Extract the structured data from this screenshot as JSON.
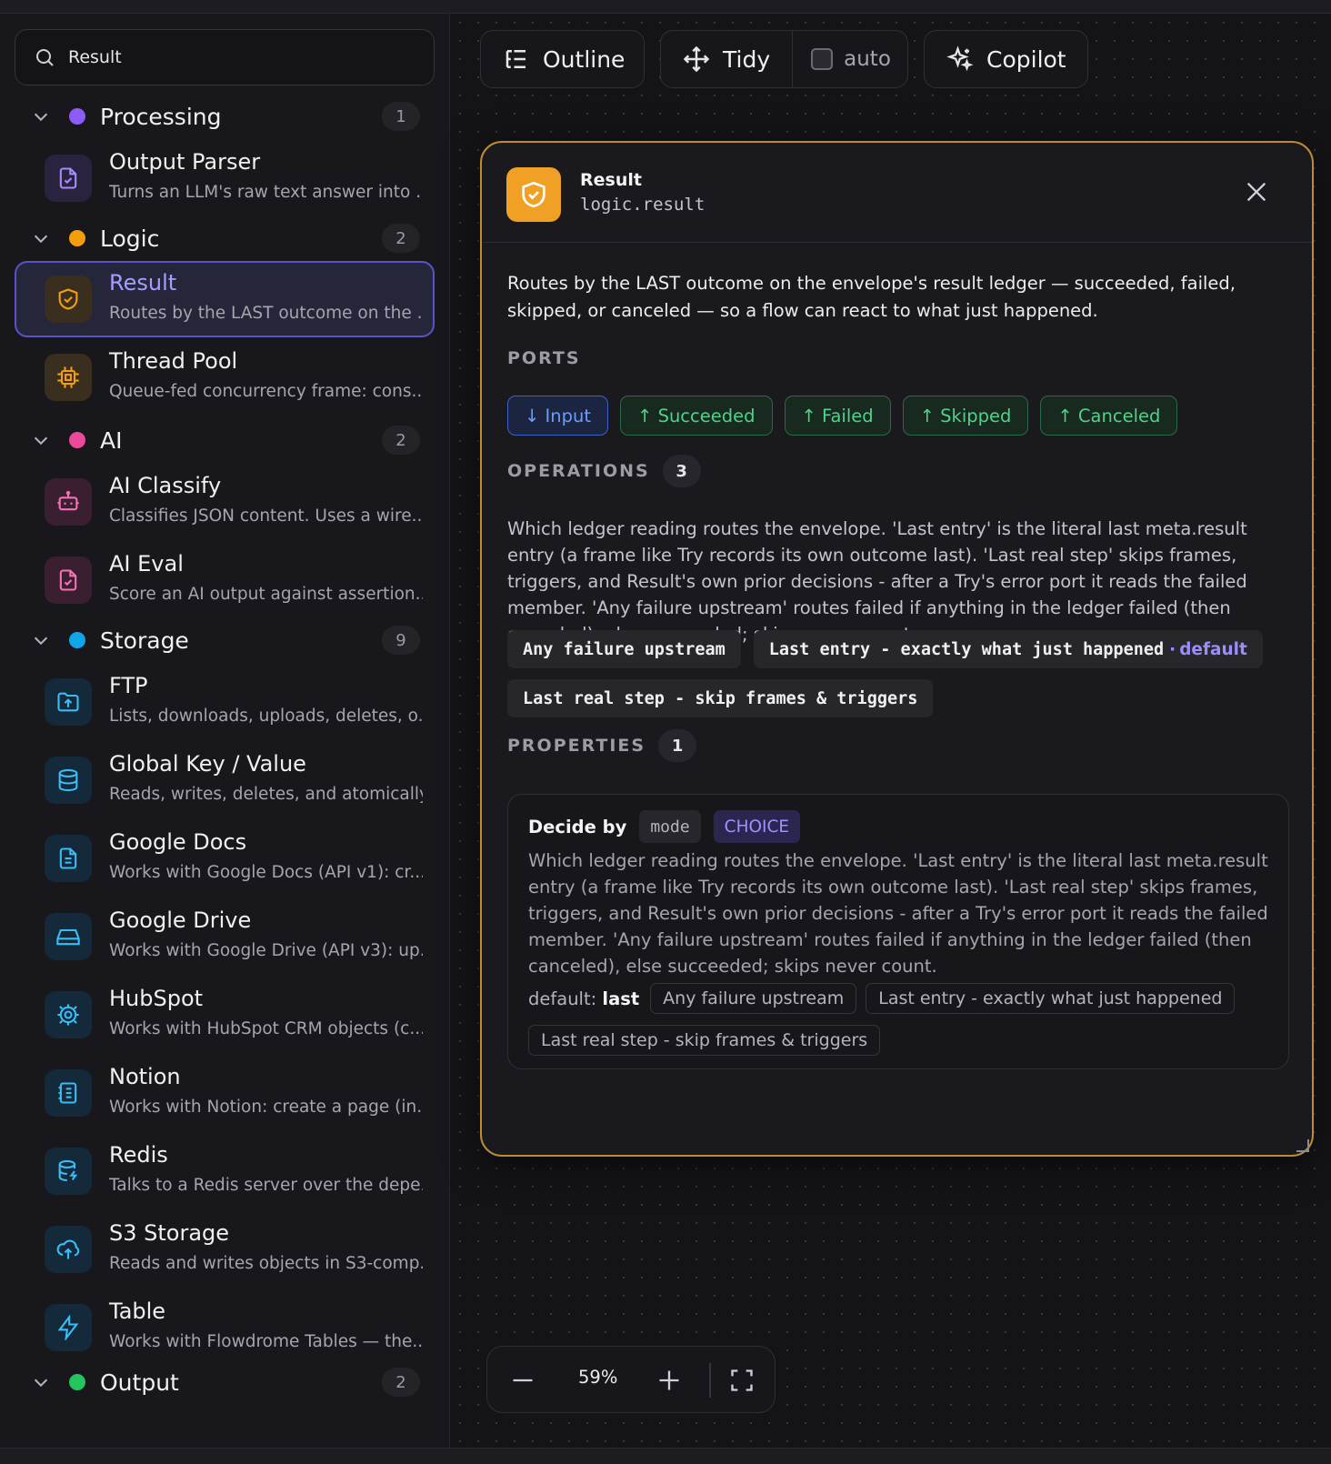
{
  "search": {
    "value": "Result"
  },
  "groups": {
    "processing": {
      "name": "Processing",
      "count": "1",
      "color": "#8b5cf6"
    },
    "logic": {
      "name": "Logic",
      "count": "2",
      "color": "#f59e0b"
    },
    "ai": {
      "name": "AI",
      "count": "2",
      "color": "#ec4899"
    },
    "storage": {
      "name": "Storage",
      "count": "9",
      "color": "#0ea5e9"
    },
    "output": {
      "name": "Output",
      "count": "2",
      "color": "#22c55e"
    }
  },
  "items": {
    "output_parser": {
      "title": "Output Parser",
      "desc": "Turns an LLM's raw text answer into ...",
      "icon": "file-check-icon"
    },
    "result": {
      "title": "Result",
      "desc": "Routes by the LAST outcome on the ...",
      "icon": "shield-check-icon"
    },
    "thread_pool": {
      "title": "Thread Pool",
      "desc": "Queue-fed concurrency frame: cons...",
      "icon": "cpu-icon"
    },
    "ai_classify": {
      "title": "AI Classify",
      "desc": "Classifies JSON content. Uses a wire...",
      "icon": "bot-icon"
    },
    "ai_eval": {
      "title": "AI Eval",
      "desc": "Score an AI output against assertion...",
      "icon": "file-check-icon"
    },
    "ftp": {
      "title": "FTP",
      "desc": "Lists, downloads, uploads, deletes, o...",
      "icon": "folder-up-icon"
    },
    "global_kv": {
      "title": "Global Key / Value",
      "desc": "Reads, writes, deletes, and atomically...",
      "icon": "database-icon"
    },
    "google_docs": {
      "title": "Google Docs",
      "desc": "Works with Google Docs (API v1): cr...",
      "icon": "file-text-icon"
    },
    "google_drive": {
      "title": "Google Drive",
      "desc": "Works with Google Drive (API v3): up...",
      "icon": "hard-drive-icon"
    },
    "hubspot": {
      "title": "HubSpot",
      "desc": "Works with HubSpot CRM objects (c...",
      "icon": "gear-icon"
    },
    "notion": {
      "title": "Notion",
      "desc": "Works with Notion: create a page (in...",
      "icon": "notebook-icon"
    },
    "redis": {
      "title": "Redis",
      "desc": "Talks to a Redis server over the depe...",
      "icon": "database-zap-icon"
    },
    "s3": {
      "title": "S3 Storage",
      "desc": "Reads and writes objects in S3-comp...",
      "icon": "cloud-upload-icon"
    },
    "table": {
      "title": "Table",
      "desc": "Works with Flowdrome Tables — the...",
      "icon": "zap-icon"
    }
  },
  "toolbar": {
    "outline": "Outline",
    "tidy": "Tidy",
    "auto": "auto",
    "copilot": "Copilot"
  },
  "panel": {
    "title": "Result",
    "type_id": "logic.result",
    "description": "Routes by the LAST outcome on the envelope's result ledger — succeeded, failed, skipped, or canceled — so a flow can react to what just happened.",
    "ports_label": "PORTS",
    "ports": {
      "input": "↓ Input",
      "succeeded": "↑ Succeeded",
      "failed": "↑ Failed",
      "skipped": "↑ Skipped",
      "canceled": "↑ Canceled"
    },
    "operations_label": "OPERATIONS",
    "operations_count": "3",
    "operations_desc": "Which ledger reading routes the envelope. 'Last entry' is the literal last meta.result entry (a frame like Try records its own outcome last). 'Last real step' skips frames, triggers, and Result's own prior decisions - after a Try's error port it reads the failed member. 'Any failure upstream' routes failed if anything in the ledger failed (then canceled), else succeeded; skips never count.",
    "operations": {
      "op1": "Any failure upstream",
      "op2": "Last entry - exactly what just happened",
      "op2_sep": "·",
      "op2_default": "default",
      "op3": "Last real step - skip frames & triggers"
    },
    "properties_label": "PROPERTIES",
    "properties_count": "1",
    "property": {
      "name": "Decide by",
      "key": "mode",
      "type": "CHOICE",
      "desc": "Which ledger reading routes the envelope. 'Last entry' is the literal last meta.result entry (a frame like Try records its own outcome last). 'Last real step' skips frames, triggers, and Result's own prior decisions - after a Try's error port it reads the failed member. 'Any failure upstream' routes failed if anything in the ledger failed (then canceled), else succeeded; skips never count.",
      "default_label": "default:",
      "default_value": "last",
      "options": {
        "o1": "Any failure upstream",
        "o2": "Last entry - exactly what just happened",
        "o3": "Last real step - skip frames & triggers"
      }
    }
  },
  "zoom": {
    "level": "59%"
  },
  "colors": {
    "accent": "#8b7dff",
    "panel_border": "#c08a2e",
    "port_in": "#6b9cff",
    "port_out": "#4fd28a"
  }
}
